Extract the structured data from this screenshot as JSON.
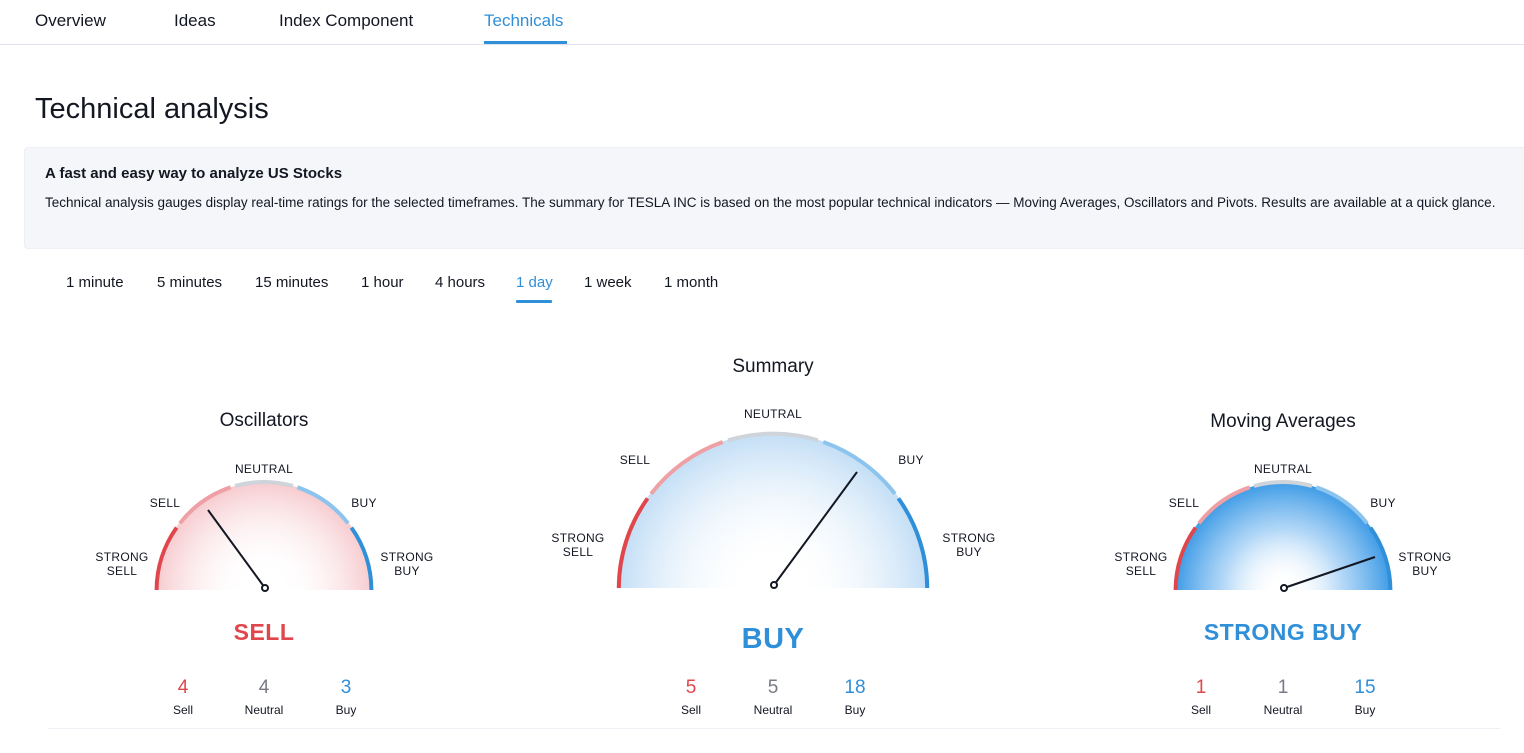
{
  "top_tabs": [
    {
      "label": "Overview",
      "active": false
    },
    {
      "label": "Ideas",
      "active": false
    },
    {
      "label": "Index Component",
      "active": false
    },
    {
      "label": "Technicals",
      "active": true
    }
  ],
  "page_title": "Technical analysis",
  "info": {
    "title": "A fast and easy way to analyze US Stocks",
    "text": "Technical analysis gauges display real-time ratings for the selected timeframes. The summary for TESLA INC is based on the most popular technical indicators — Moving Averages, Oscillators and Pivots. Results are available at a quick glance."
  },
  "timeframes": [
    {
      "label": "1 minute",
      "active": false
    },
    {
      "label": "5 minutes",
      "active": false
    },
    {
      "label": "15 minutes",
      "active": false
    },
    {
      "label": "1 hour",
      "active": false
    },
    {
      "label": "4 hours",
      "active": false
    },
    {
      "label": "1 day",
      "active": true
    },
    {
      "label": "1 week",
      "active": false
    },
    {
      "label": "1 month",
      "active": false
    }
  ],
  "gauge_labels": {
    "strong_sell": "STRONG\nSELL",
    "sell": "SELL",
    "neutral": "NEUTRAL",
    "buy": "BUY",
    "strong_buy": "STRONG\nBUY"
  },
  "count_labels": {
    "sell": "Sell",
    "neutral": "Neutral",
    "buy": "Buy"
  },
  "colors": {
    "sell": "#e0474c",
    "neutral": "#787b86",
    "buy": "#2f8fd8"
  },
  "gauges": {
    "oscillators": {
      "title": "Oscillators",
      "verdict": "SELL",
      "verdict_tone": "sell",
      "counts": {
        "sell": "4",
        "neutral": "4",
        "buy": "3"
      }
    },
    "summary": {
      "title": "Summary",
      "verdict": "BUY",
      "verdict_tone": "buy",
      "counts": {
        "sell": "5",
        "neutral": "5",
        "buy": "18"
      }
    },
    "moving_averages": {
      "title": "Moving Averages",
      "verdict": "STRONG BUY",
      "verdict_tone": "buy",
      "counts": {
        "sell": "1",
        "neutral": "1",
        "buy": "15"
      }
    }
  }
}
